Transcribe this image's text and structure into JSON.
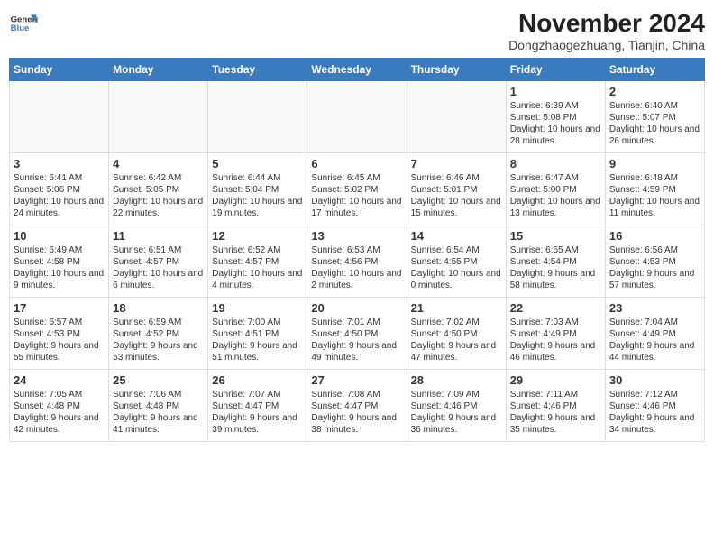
{
  "header": {
    "logo_line1": "General",
    "logo_line2": "Blue",
    "month_title": "November 2024",
    "location": "Dongzhaogezhuang, Tianjin, China"
  },
  "days_of_week": [
    "Sunday",
    "Monday",
    "Tuesday",
    "Wednesday",
    "Thursday",
    "Friday",
    "Saturday"
  ],
  "weeks": [
    [
      {
        "day": "",
        "info": ""
      },
      {
        "day": "",
        "info": ""
      },
      {
        "day": "",
        "info": ""
      },
      {
        "day": "",
        "info": ""
      },
      {
        "day": "",
        "info": ""
      },
      {
        "day": "1",
        "info": "Sunrise: 6:39 AM\nSunset: 5:08 PM\nDaylight: 10 hours and 28 minutes."
      },
      {
        "day": "2",
        "info": "Sunrise: 6:40 AM\nSunset: 5:07 PM\nDaylight: 10 hours and 26 minutes."
      }
    ],
    [
      {
        "day": "3",
        "info": "Sunrise: 6:41 AM\nSunset: 5:06 PM\nDaylight: 10 hours and 24 minutes."
      },
      {
        "day": "4",
        "info": "Sunrise: 6:42 AM\nSunset: 5:05 PM\nDaylight: 10 hours and 22 minutes."
      },
      {
        "day": "5",
        "info": "Sunrise: 6:44 AM\nSunset: 5:04 PM\nDaylight: 10 hours and 19 minutes."
      },
      {
        "day": "6",
        "info": "Sunrise: 6:45 AM\nSunset: 5:02 PM\nDaylight: 10 hours and 17 minutes."
      },
      {
        "day": "7",
        "info": "Sunrise: 6:46 AM\nSunset: 5:01 PM\nDaylight: 10 hours and 15 minutes."
      },
      {
        "day": "8",
        "info": "Sunrise: 6:47 AM\nSunset: 5:00 PM\nDaylight: 10 hours and 13 minutes."
      },
      {
        "day": "9",
        "info": "Sunrise: 6:48 AM\nSunset: 4:59 PM\nDaylight: 10 hours and 11 minutes."
      }
    ],
    [
      {
        "day": "10",
        "info": "Sunrise: 6:49 AM\nSunset: 4:58 PM\nDaylight: 10 hours and 9 minutes."
      },
      {
        "day": "11",
        "info": "Sunrise: 6:51 AM\nSunset: 4:57 PM\nDaylight: 10 hours and 6 minutes."
      },
      {
        "day": "12",
        "info": "Sunrise: 6:52 AM\nSunset: 4:57 PM\nDaylight: 10 hours and 4 minutes."
      },
      {
        "day": "13",
        "info": "Sunrise: 6:53 AM\nSunset: 4:56 PM\nDaylight: 10 hours and 2 minutes."
      },
      {
        "day": "14",
        "info": "Sunrise: 6:54 AM\nSunset: 4:55 PM\nDaylight: 10 hours and 0 minutes."
      },
      {
        "day": "15",
        "info": "Sunrise: 6:55 AM\nSunset: 4:54 PM\nDaylight: 9 hours and 58 minutes."
      },
      {
        "day": "16",
        "info": "Sunrise: 6:56 AM\nSunset: 4:53 PM\nDaylight: 9 hours and 57 minutes."
      }
    ],
    [
      {
        "day": "17",
        "info": "Sunrise: 6:57 AM\nSunset: 4:53 PM\nDaylight: 9 hours and 55 minutes."
      },
      {
        "day": "18",
        "info": "Sunrise: 6:59 AM\nSunset: 4:52 PM\nDaylight: 9 hours and 53 minutes."
      },
      {
        "day": "19",
        "info": "Sunrise: 7:00 AM\nSunset: 4:51 PM\nDaylight: 9 hours and 51 minutes."
      },
      {
        "day": "20",
        "info": "Sunrise: 7:01 AM\nSunset: 4:50 PM\nDaylight: 9 hours and 49 minutes."
      },
      {
        "day": "21",
        "info": "Sunrise: 7:02 AM\nSunset: 4:50 PM\nDaylight: 9 hours and 47 minutes."
      },
      {
        "day": "22",
        "info": "Sunrise: 7:03 AM\nSunset: 4:49 PM\nDaylight: 9 hours and 46 minutes."
      },
      {
        "day": "23",
        "info": "Sunrise: 7:04 AM\nSunset: 4:49 PM\nDaylight: 9 hours and 44 minutes."
      }
    ],
    [
      {
        "day": "24",
        "info": "Sunrise: 7:05 AM\nSunset: 4:48 PM\nDaylight: 9 hours and 42 minutes."
      },
      {
        "day": "25",
        "info": "Sunrise: 7:06 AM\nSunset: 4:48 PM\nDaylight: 9 hours and 41 minutes."
      },
      {
        "day": "26",
        "info": "Sunrise: 7:07 AM\nSunset: 4:47 PM\nDaylight: 9 hours and 39 minutes."
      },
      {
        "day": "27",
        "info": "Sunrise: 7:08 AM\nSunset: 4:47 PM\nDaylight: 9 hours and 38 minutes."
      },
      {
        "day": "28",
        "info": "Sunrise: 7:09 AM\nSunset: 4:46 PM\nDaylight: 9 hours and 36 minutes."
      },
      {
        "day": "29",
        "info": "Sunrise: 7:11 AM\nSunset: 4:46 PM\nDaylight: 9 hours and 35 minutes."
      },
      {
        "day": "30",
        "info": "Sunrise: 7:12 AM\nSunset: 4:46 PM\nDaylight: 9 hours and 34 minutes."
      }
    ]
  ]
}
